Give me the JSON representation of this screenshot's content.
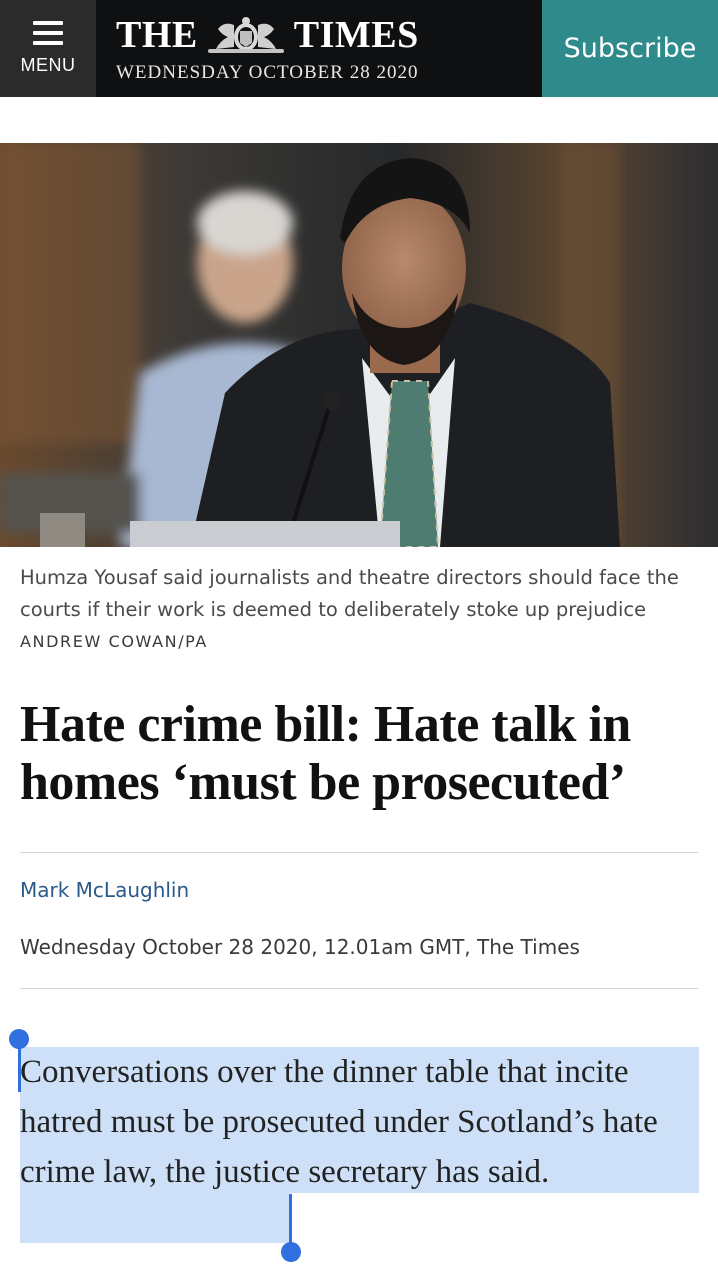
{
  "header": {
    "menu_label": "MENU",
    "logo_left": "THE",
    "logo_right": "TIMES",
    "date": "WEDNESDAY OCTOBER 28 2020",
    "subscribe_label": "Subscribe",
    "colors": {
      "masthead": "#0f1012",
      "menu": "#2b2b2b",
      "subscribe": "#2f8a8c"
    }
  },
  "article": {
    "caption": "Humza Yousaf said journalists and theatre directors should face the courts if their work is deemed to deliberately stoke up prejudice",
    "photo_credit": "ANDREW COWAN/PA",
    "headline": "Hate crime bill: Hate talk in homes ‘must be prosecuted’",
    "author": "Mark McLaughlin",
    "published": "Wednesday October 28 2020, 12.01am GMT, The Times",
    "body": "Conversations over the dinner table that incite hatred must be prosecuted under Scotland’s hate crime law, the justice secretary has said.",
    "colors": {
      "author_link": "#2a5a8a",
      "selection": "#cde0f7",
      "selection_handle": "#2f6fde"
    }
  }
}
